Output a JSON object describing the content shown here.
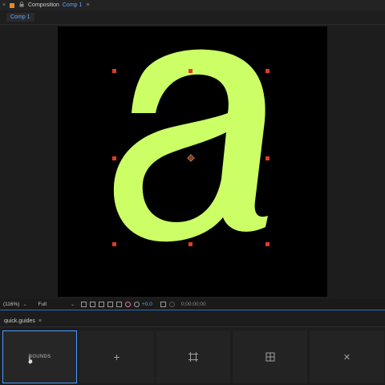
{
  "panel": {
    "close": "×",
    "lock": "🔒",
    "title": "Composition",
    "comp_name": "Comp 1",
    "menu": "≡"
  },
  "tabs": [
    {
      "label": "Comp 1"
    }
  ],
  "viewer": {
    "glyph": "a",
    "glyph_color": "#ccff66",
    "handle_color": "#e03c28",
    "anchor_color": "#e6884c"
  },
  "toolbar": {
    "zoom": "(116%)",
    "quality": "Full",
    "exposure": "+0.0",
    "timecode": "0;00;00;00"
  },
  "quick_guides": {
    "title": "quick.guides",
    "menu": "≡",
    "tiles": [
      {
        "label": "BOUNDS"
      },
      {
        "icon": "plus-icon",
        "glyph": "+"
      },
      {
        "icon": "crop-square-icon"
      },
      {
        "icon": "grid-square-icon"
      },
      {
        "icon": "close-icon",
        "glyph": "✕"
      }
    ]
  },
  "colors": {
    "accent": "#59a6ff",
    "comp_square": "#e88a2c",
    "active_border": "#4d9cff"
  }
}
